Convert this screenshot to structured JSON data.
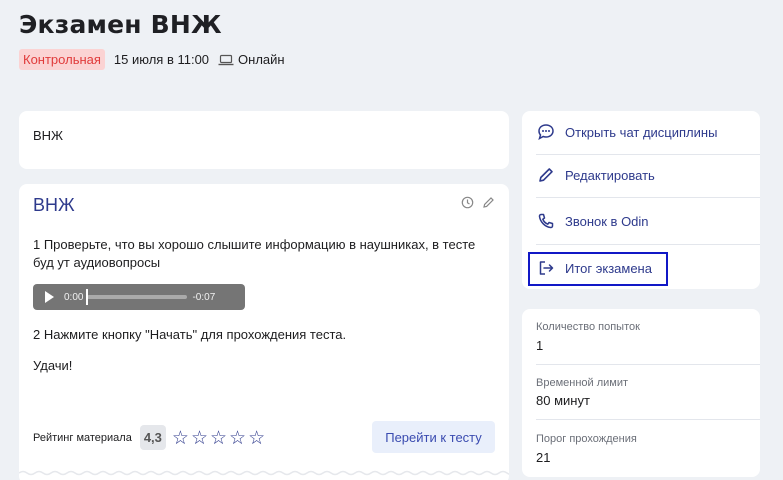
{
  "page": {
    "title": "Экзамен ВНЖ",
    "badge": "Контрольная",
    "date": "15 июля в 11:00",
    "format": "Онлайн"
  },
  "topic_card": {
    "text": "ВНЖ"
  },
  "main_card": {
    "title": "ВНЖ",
    "paragraph1": "1 Проверьте, что вы хорошо слышите  информацию в наушниках, в тесте буд ут аудиовопросы",
    "audio": {
      "current": "0:00",
      "remaining": "-0:07"
    },
    "paragraph2": "2 Нажмите кнопку \"Начать\" для прохождения теста.",
    "paragraph3": "Удачи!",
    "rating_label": "Рейтинг материала",
    "rating_value": "4,3",
    "stars_filled": 0,
    "stars_total": 5,
    "test_button": "Перейти к тесту"
  },
  "actions": [
    {
      "label": "Открыть чат дисциплины",
      "icon": "chat-icon"
    },
    {
      "label": "Редактировать",
      "icon": "pencil-icon"
    },
    {
      "label": "Звонок в Odin",
      "icon": "phone-icon"
    },
    {
      "label": "Итог экзамена",
      "icon": "exit-icon"
    }
  ],
  "info": [
    {
      "label": "Количество попыток",
      "value": "1"
    },
    {
      "label": "Временной лимит",
      "value": "80 минут"
    },
    {
      "label": "Порог прохождения",
      "value": "21"
    }
  ],
  "colors": {
    "background": "#eef1f5",
    "accent": "#2e3a8c",
    "badge_bg": "#fbd3d3",
    "badge_text": "#e03b3b",
    "highlight": "#1118c6"
  }
}
